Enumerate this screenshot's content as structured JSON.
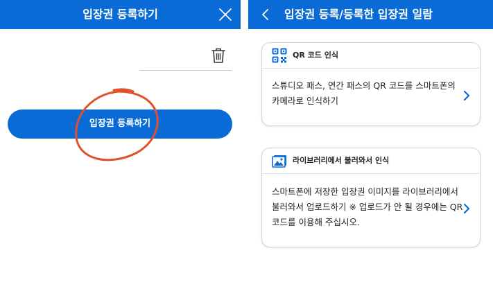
{
  "colors": {
    "brand_blue": "#0b6bd6",
    "header_text": "#ffffff",
    "annotation_red": "#e0512b"
  },
  "left_screen": {
    "header": {
      "title": "입장권 등록하기",
      "close_icon": "close-icon"
    },
    "ticket_input": {
      "value": "",
      "placeholder": ""
    },
    "trash_icon": "trash-icon",
    "register_button_label": "입장권 등록하기",
    "annotation": "red-circle-annotation"
  },
  "right_screen": {
    "header": {
      "title": "입장권 등록/등록한 입장권 일람",
      "back_icon": "chevron-left-icon"
    },
    "cards": [
      {
        "icon": "qr-code-icon",
        "title": "QR 코드 인식",
        "description": "스튜디오 패스, 연간 패스의 QR 코드를 스마트폰의 카메라로 인식하기",
        "chevron_icon": "chevron-right-icon"
      },
      {
        "icon": "image-library-icon",
        "title": "라이브러리에서 불러와서 인식",
        "description": "스마트폰에 저장한 입장권 이미지를 라이브러리에서 불러와서 업로드하기 ※ 업로드가 안 될 경우에는 QR 코드를 이용해 주십시오.",
        "chevron_icon": "chevron-right-icon"
      }
    ]
  }
}
